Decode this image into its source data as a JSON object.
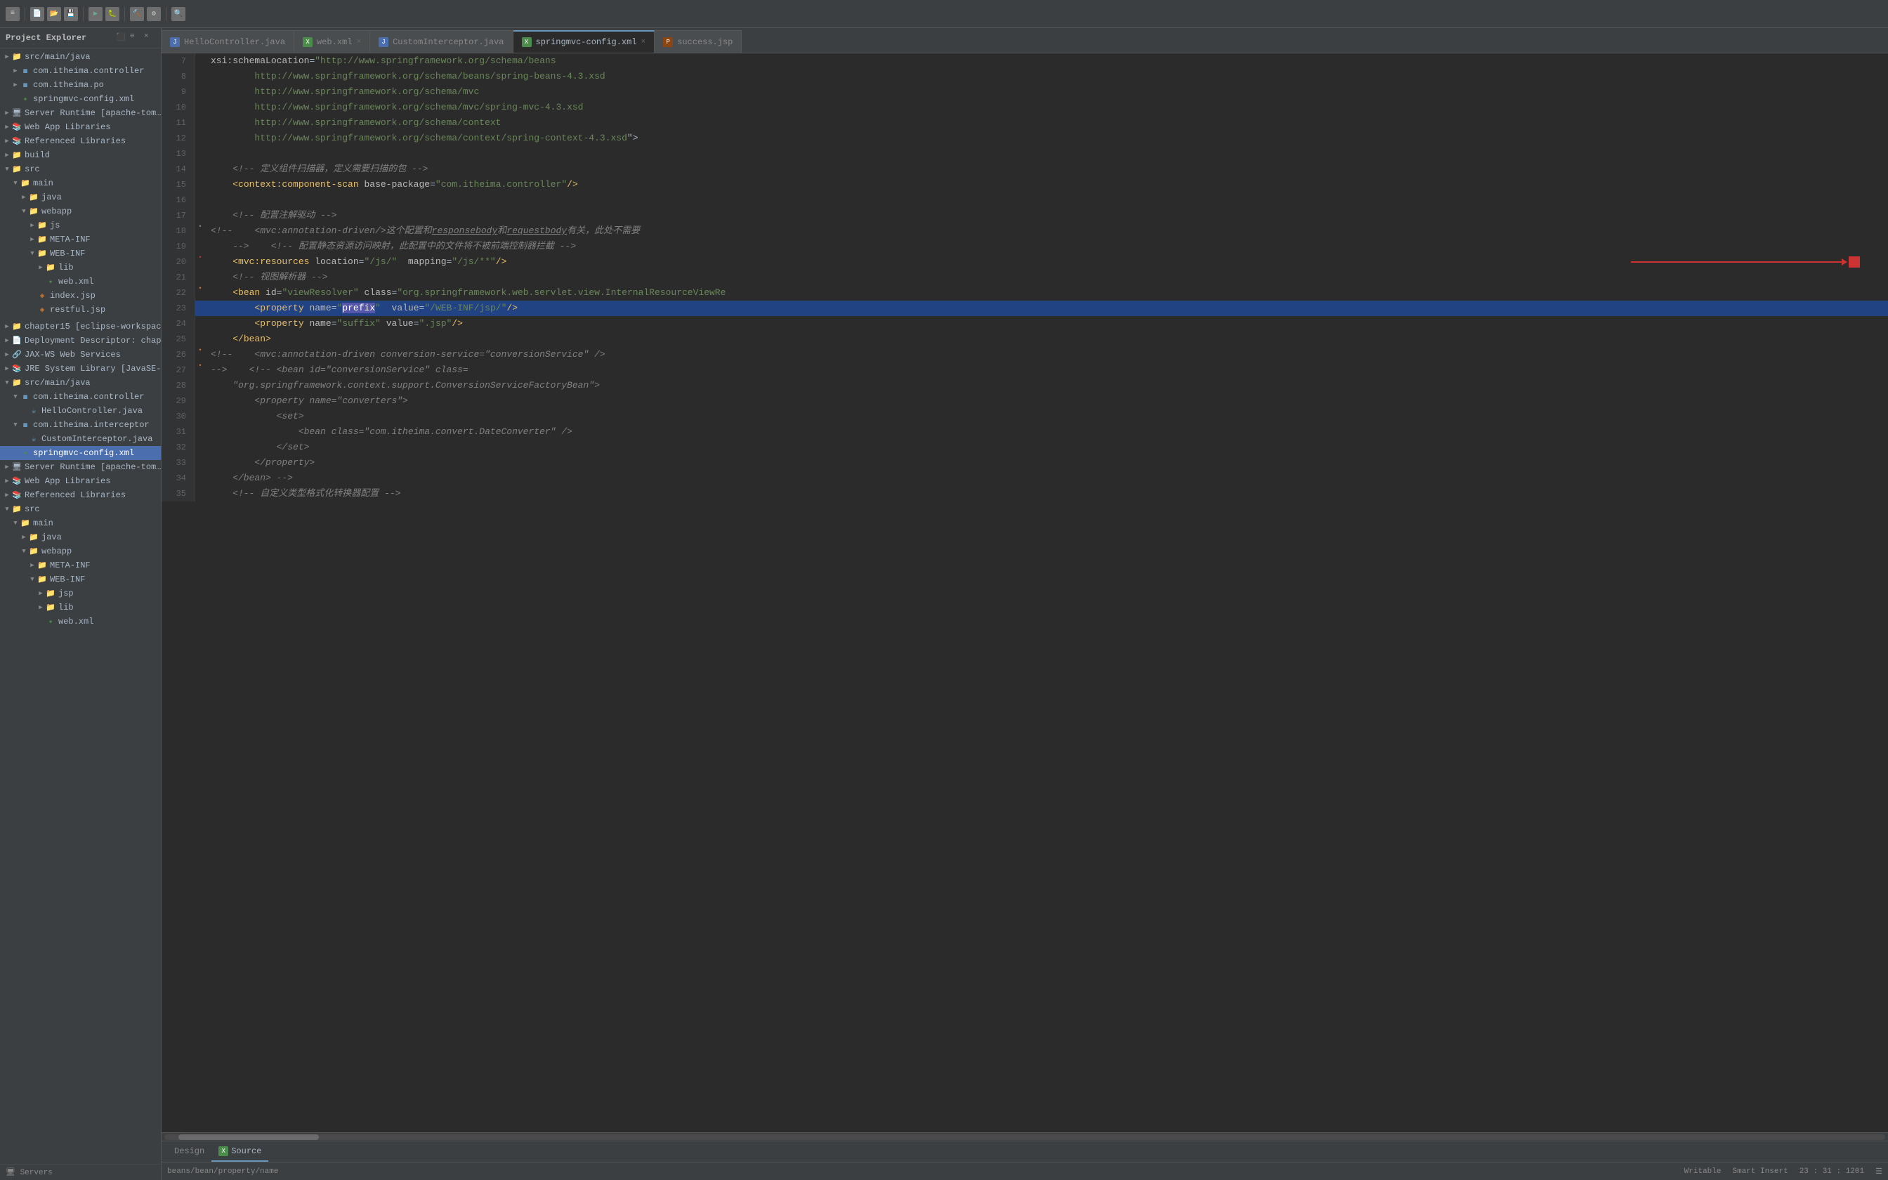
{
  "toolbar": {
    "icons": [
      "≡",
      "⬚",
      "▶",
      "⏸",
      "⏹",
      "🔧",
      "🔍"
    ]
  },
  "sidebar": {
    "title": "Project Explorer",
    "close_label": "×",
    "items": [
      {
        "id": "src-main-java",
        "label": "src/main/java",
        "indent": 0,
        "arrow": "▶",
        "icon": "📁"
      },
      {
        "id": "com-itheima-controller",
        "label": "com.itheima.controller",
        "indent": 1,
        "arrow": "▶",
        "icon": "📦"
      },
      {
        "id": "com-itheima-po",
        "label": "com.itheima.po",
        "indent": 1,
        "arrow": "▶",
        "icon": "📦"
      },
      {
        "id": "springmvc-config-xml",
        "label": "springmvc-config.xml",
        "indent": 1,
        "arrow": " ",
        "icon": "📄"
      },
      {
        "id": "server-runtime",
        "label": "Server Runtime [apache-tom…",
        "indent": 0,
        "arrow": "▶",
        "icon": "🖥"
      },
      {
        "id": "web-app-libraries",
        "label": "Web App Libraries",
        "indent": 0,
        "arrow": "▶",
        "icon": "📚"
      },
      {
        "id": "referenced-libraries-1",
        "label": "Referenced Libraries",
        "indent": 0,
        "arrow": "▶",
        "icon": "📚"
      },
      {
        "id": "build",
        "label": "build",
        "indent": 0,
        "arrow": "▶",
        "icon": "📁"
      },
      {
        "id": "src",
        "label": "src",
        "indent": 0,
        "arrow": "▼",
        "icon": "📁"
      },
      {
        "id": "main",
        "label": "main",
        "indent": 1,
        "arrow": "▼",
        "icon": "📁"
      },
      {
        "id": "java",
        "label": "java",
        "indent": 2,
        "arrow": "▶",
        "icon": "📁"
      },
      {
        "id": "webapp",
        "label": "webapp",
        "indent": 2,
        "arrow": "▼",
        "icon": "📁"
      },
      {
        "id": "js",
        "label": "js",
        "indent": 3,
        "arrow": "▶",
        "icon": "📁"
      },
      {
        "id": "meta-inf",
        "label": "META-INF",
        "indent": 3,
        "arrow": "▶",
        "icon": "📁"
      },
      {
        "id": "web-inf",
        "label": "WEB-INF",
        "indent": 3,
        "arrow": "▼",
        "icon": "📁"
      },
      {
        "id": "lib",
        "label": "lib",
        "indent": 4,
        "arrow": "▶",
        "icon": "📁"
      },
      {
        "id": "web-xml",
        "label": "web.xml",
        "indent": 4,
        "arrow": " ",
        "icon": "📄"
      },
      {
        "id": "index-jsp",
        "label": "index.jsp",
        "indent": 3,
        "arrow": " ",
        "icon": "📄"
      },
      {
        "id": "restful-jsp",
        "label": "restful.jsp",
        "indent": 3,
        "arrow": " ",
        "icon": "📄"
      },
      {
        "id": "chapter15",
        "label": "chapter15 [eclipse-workspace…",
        "indent": 0,
        "arrow": "▶",
        "icon": "📁"
      },
      {
        "id": "deployment-descriptor",
        "label": "Deployment Descriptor: chap…",
        "indent": 0,
        "arrow": "▶",
        "icon": "📄"
      },
      {
        "id": "jax-ws-web-services",
        "label": "JAX-WS Web Services",
        "indent": 0,
        "arrow": "▶",
        "icon": "🔗"
      },
      {
        "id": "jre-system-library",
        "label": "JRE System Library [JavaSE-…",
        "indent": 0,
        "arrow": "▶",
        "icon": "📚"
      },
      {
        "id": "src-main-java-2",
        "label": "src/main/java",
        "indent": 0,
        "arrow": "▼",
        "icon": "📁"
      },
      {
        "id": "com-itheima-controller-2",
        "label": "com.itheima.controller",
        "indent": 1,
        "arrow": "▼",
        "icon": "📦"
      },
      {
        "id": "hello-controller-java",
        "label": "HelloController.java",
        "indent": 2,
        "arrow": " ",
        "icon": "☕"
      },
      {
        "id": "com-itheima-interceptor",
        "label": "com.itheima.interceptor",
        "indent": 1,
        "arrow": "▼",
        "icon": "📦"
      },
      {
        "id": "custom-interceptor-java",
        "label": "CustomInterceptor.java",
        "indent": 2,
        "arrow": " ",
        "icon": "☕"
      },
      {
        "id": "springmvc-config-xml-2",
        "label": "springmvc-config.xml",
        "indent": 1,
        "arrow": " ",
        "icon": "📄",
        "selected": true
      },
      {
        "id": "server-runtime-2",
        "label": "Server Runtime [apache-tom…",
        "indent": 0,
        "arrow": "▶",
        "icon": "🖥"
      },
      {
        "id": "web-app-libraries-2",
        "label": "Web App Libraries",
        "indent": 0,
        "arrow": "▶",
        "icon": "📚"
      },
      {
        "id": "referenced-libraries-2",
        "label": "Referenced Libraries",
        "indent": 0,
        "arrow": "▶",
        "icon": "📚"
      },
      {
        "id": "src-2",
        "label": "src",
        "indent": 0,
        "arrow": "▼",
        "icon": "📁"
      },
      {
        "id": "main-2",
        "label": "main",
        "indent": 1,
        "arrow": "▼",
        "icon": "📁"
      },
      {
        "id": "java-2",
        "label": "java",
        "indent": 2,
        "arrow": "▶",
        "icon": "📁"
      },
      {
        "id": "webapp-2",
        "label": "webapp",
        "indent": 2,
        "arrow": "▼",
        "icon": "📁"
      },
      {
        "id": "meta-inf-2",
        "label": "META-INF",
        "indent": 3,
        "arrow": "▶",
        "icon": "📁"
      },
      {
        "id": "web-inf-2",
        "label": "WEB-INF",
        "indent": 3,
        "arrow": "▼",
        "icon": "📁"
      },
      {
        "id": "jsp",
        "label": "jsp",
        "indent": 4,
        "arrow": "▶",
        "icon": "📁"
      },
      {
        "id": "lib-2",
        "label": "lib",
        "indent": 4,
        "arrow": "▶",
        "icon": "📁"
      },
      {
        "id": "web-xml-2",
        "label": "web.xml",
        "indent": 4,
        "arrow": " ",
        "icon": "📄"
      }
    ],
    "bottom": "Servers"
  },
  "tabs": [
    {
      "id": "hello-controller",
      "label": "HelloController.java",
      "type": "java",
      "active": false
    },
    {
      "id": "web-xml",
      "label": "web.xml",
      "type": "xml",
      "active": false,
      "close": true
    },
    {
      "id": "custom-interceptor",
      "label": "CustomInterceptor.java",
      "type": "java",
      "active": false
    },
    {
      "id": "springmvc-config",
      "label": "springmvc-config.xml",
      "type": "xml",
      "active": true,
      "close": true
    },
    {
      "id": "success-jsp",
      "label": "success.jsp",
      "type": "jsp",
      "active": false
    }
  ],
  "code": {
    "lines": [
      {
        "num": 7,
        "content": "    xsi:schemaLocation=\"http://www.springframework.org/schema/beans"
      },
      {
        "num": 8,
        "content": "        http://www.springframework.org/schema/beans/spring-beans-4.3.xsd"
      },
      {
        "num": 9,
        "content": "        http://www.springframework.org/schema/mvc"
      },
      {
        "num": 10,
        "content": "        http://www.springframework.org/schema/mvc/spring-mvc-4.3.xsd"
      },
      {
        "num": 11,
        "content": "        http://www.springframework.org/schema/context"
      },
      {
        "num": 12,
        "content": "        http://www.springframework.org/schema/context/spring-context-4.3.xsd\">"
      },
      {
        "num": 13,
        "content": ""
      },
      {
        "num": 14,
        "content": "    <!-- 定义组件扫描器，定义需要扫描的包 -->"
      },
      {
        "num": 15,
        "content": "    <context:component-scan base-package=\"com.itheima.controller\"/>"
      },
      {
        "num": 16,
        "content": ""
      },
      {
        "num": 17,
        "content": "    <!-- 配置注解驱动 -->"
      },
      {
        "num": 18,
        "content": "<!--    <mvc:annotation-driven/>这个配置和responsebody和requestbody有关，此处不需要"
      },
      {
        "num": 19,
        "content": "    -->    <!-- 配置静态资源访问映射，此配置中的文件将不被前端控制器拦截 -->"
      },
      {
        "num": 20,
        "content": "    <mvc:resources location=\"/js/\"  mapping=\"/js/**\"/>",
        "has_arrow": true,
        "indicator": "•"
      },
      {
        "num": 21,
        "content": "    <!-- 视图解析器 -->"
      },
      {
        "num": 22,
        "content": "    <bean id=\"viewResolver\" class=\"org.springframework.web.servlet.view.InternalResourceViewRe",
        "indicator": "•"
      },
      {
        "num": 23,
        "content": "        <property name=\"prefix\"  value=\"/WEB-INF/jsp/\"/>",
        "selected": true
      },
      {
        "num": 24,
        "content": "        <property name=\"suffix\" value=\".jsp\"/>"
      },
      {
        "num": 25,
        "content": "    </bean>"
      },
      {
        "num": 26,
        "content": "<!--    <mvc:annotation-driven conversion-service=\"conversionService\" />",
        "indicator": "•"
      },
      {
        "num": 27,
        "content": "-->    <!-- <bean id=\"conversionService\" class=",
        "indicator": "•"
      },
      {
        "num": 28,
        "content": "        \"org.springframework.context.support.ConversionServiceFactoryBean\">"
      },
      {
        "num": 29,
        "content": "        <property name=\"converters\">"
      },
      {
        "num": 30,
        "content": "            <set>"
      },
      {
        "num": 31,
        "content": "                <bean class=\"com.itheima.convert.DateConverter\" />"
      },
      {
        "num": 32,
        "content": "            </set>"
      },
      {
        "num": 33,
        "content": "        </property>"
      },
      {
        "num": 34,
        "content": "    </bean> -->"
      },
      {
        "num": 35,
        "content": "    <!-- 自定义类型格式化转换器配置 -->"
      }
    ]
  },
  "bottom_tabs": [
    {
      "id": "design",
      "label": "Design",
      "active": false
    },
    {
      "id": "source",
      "label": "Source",
      "active": true,
      "icon": "xml"
    }
  ],
  "status_bar": {
    "file_path": "beans/bean/property/name",
    "writable": "Writable",
    "insert_mode": "Smart Insert",
    "position": "23 : 31 : 1201",
    "menu_icon": "☰"
  }
}
